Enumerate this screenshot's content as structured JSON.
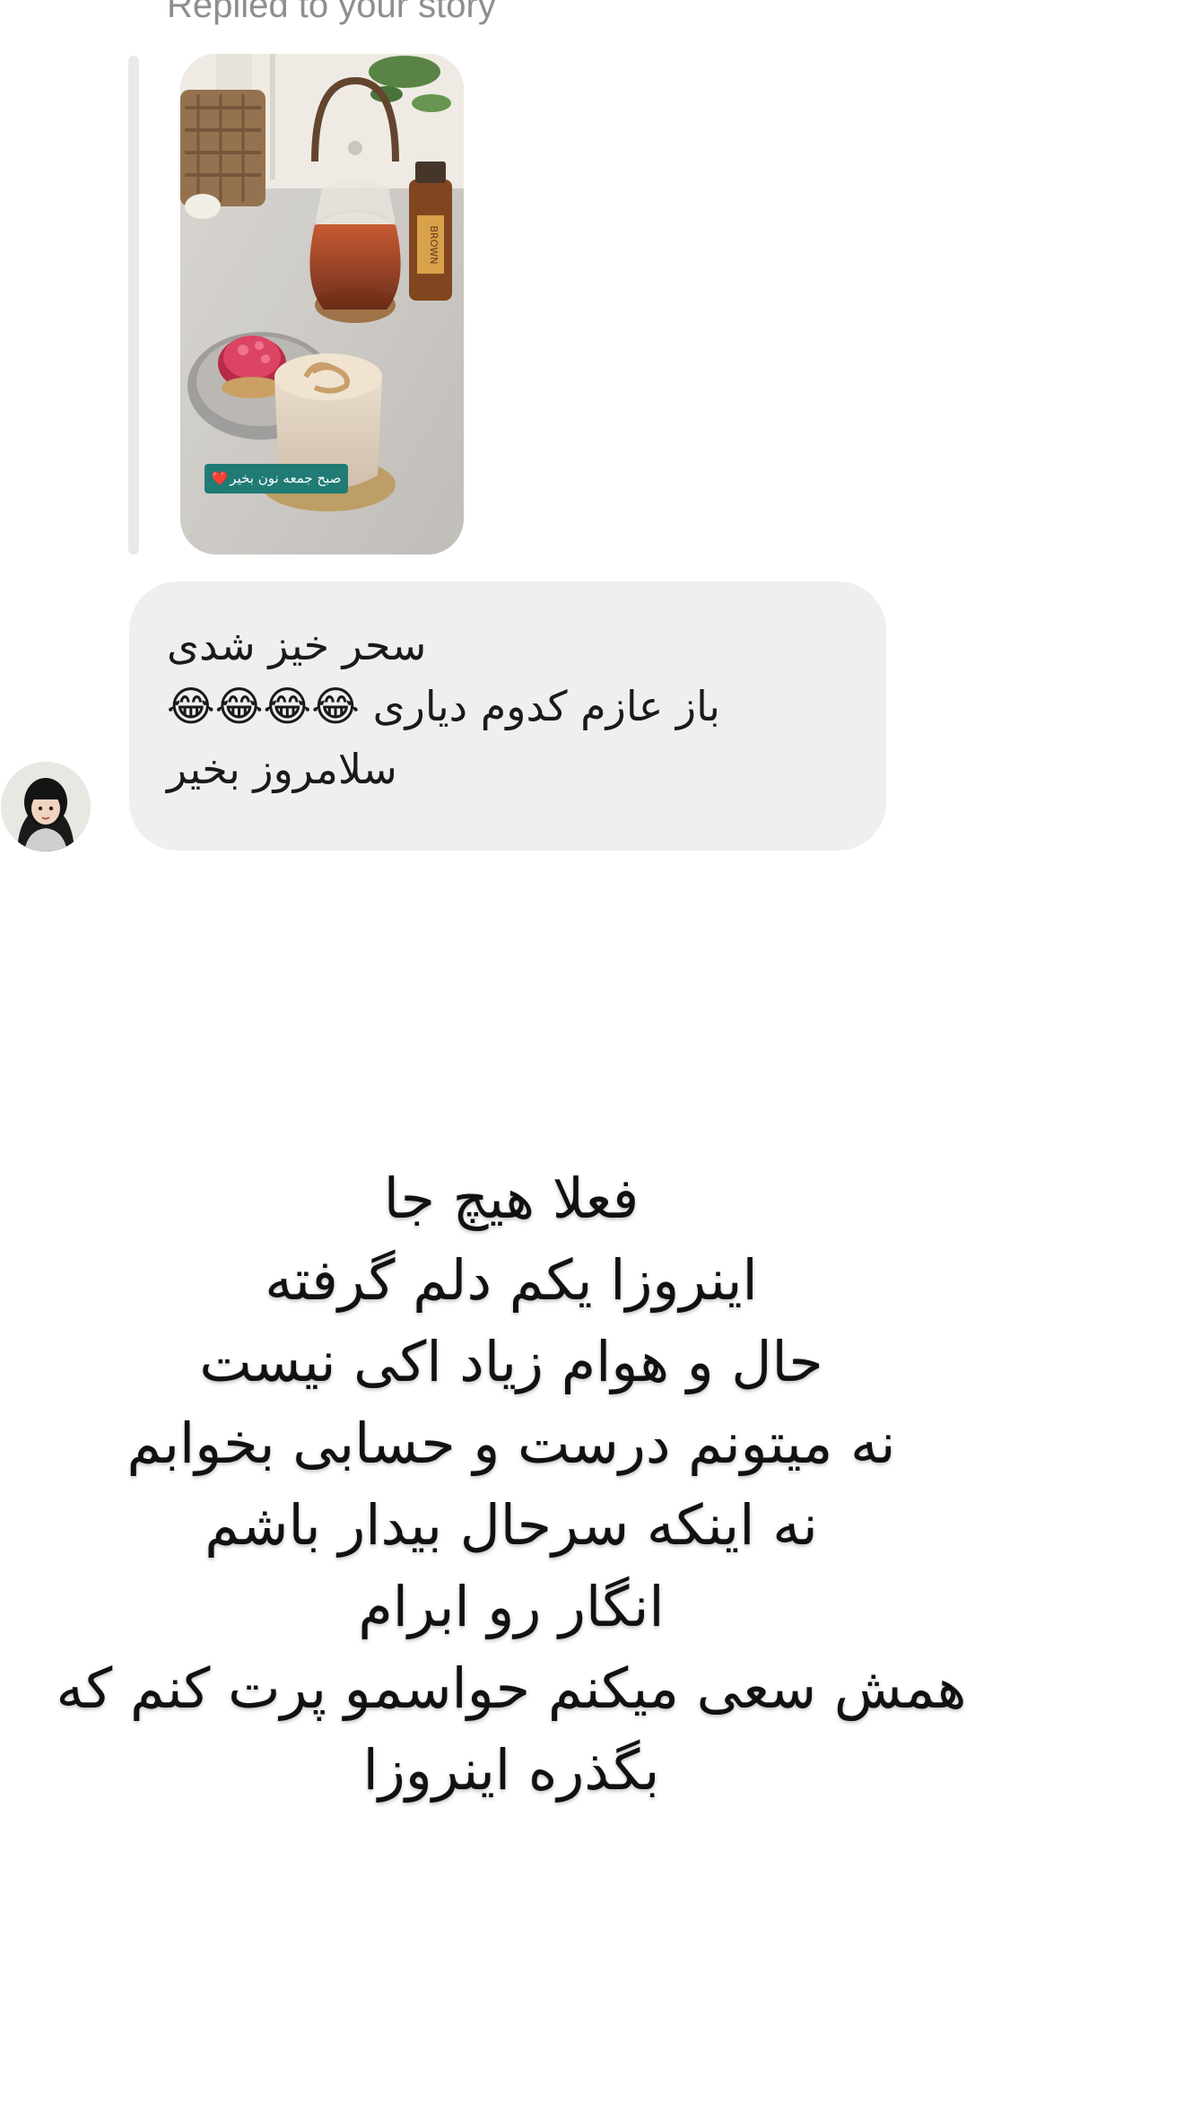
{
  "reply_header": {
    "label": "Replied to your story"
  },
  "story": {
    "caption_text": "صبح جمعه نون بخیر",
    "caption_emoji": "❤️",
    "bottle_label": "BROWN"
  },
  "message": {
    "lines": [
      "سحر خیز  شدی",
      "باز عازم کدوم دیاری 😂😂😂😂",
      "سلامروز بخیر"
    ]
  },
  "overlay_text": {
    "lines": [
      "فعلا هیچ جا",
      "اینروزا یکم دلم گرفته",
      "حال و هوام زیاد اکی نیست",
      "نه میتونم درست و حسابی بخوابم",
      "نه اینکه سرحال بیدار باشم",
      "انگار رو ابرام",
      "همش سعی میکنم حواسمو پرت کنم که",
      "بگذره اینروزا"
    ]
  },
  "colors": {
    "bubble_bg": "#efeff1",
    "reply_bar": "#e8e9eb",
    "muted_text": "#8e8e8e",
    "caption_bg": "#1f7b74"
  }
}
